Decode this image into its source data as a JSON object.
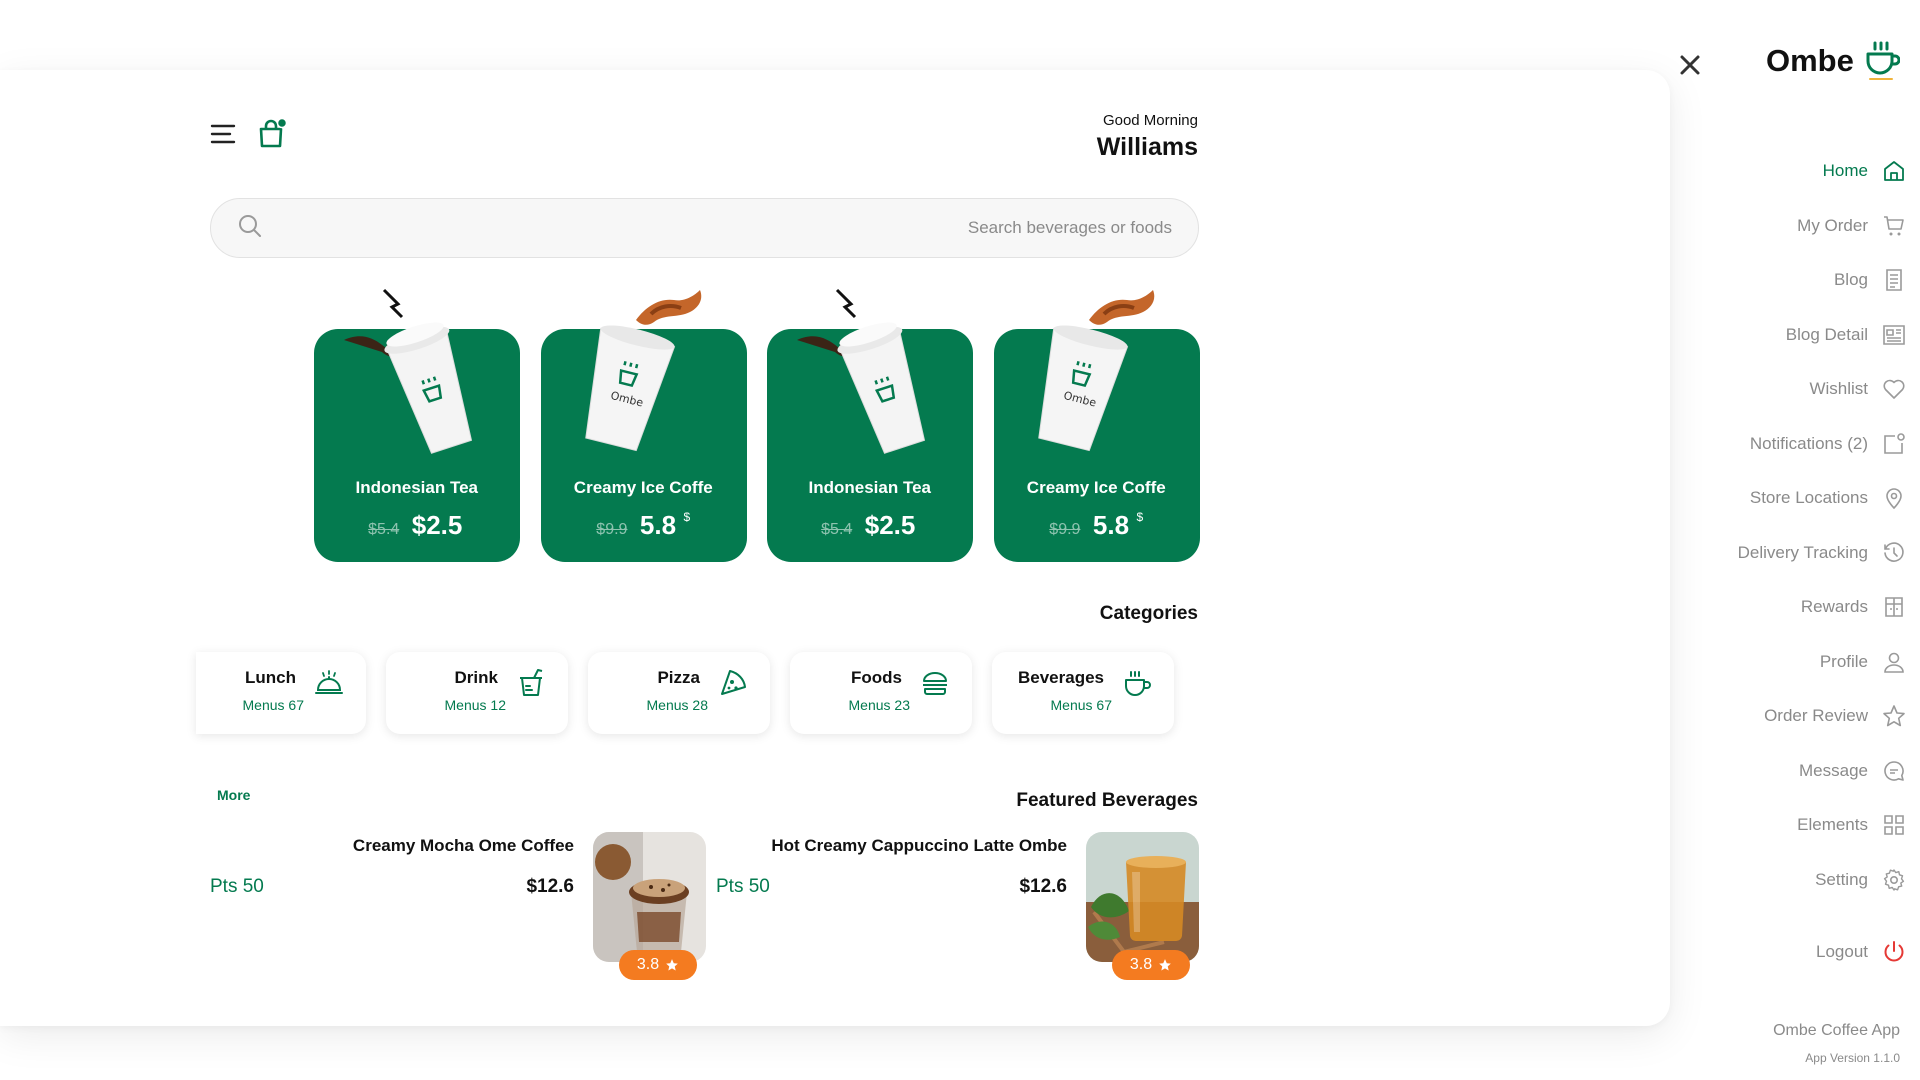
{
  "header": {
    "greeting": "Good Morning",
    "user_name": "Williams",
    "menu_icon": "menu-icon",
    "bag_icon": "shopping-bag-icon"
  },
  "search": {
    "placeholder": "Search beverages or foods"
  },
  "products": [
    {
      "name": "Indonesian Tea",
      "old_price": "$5.4",
      "price": "$2.5",
      "currency": ""
    },
    {
      "name": "Creamy Ice Coffe",
      "old_price": "$9.9",
      "price": "5.8",
      "currency": "$"
    },
    {
      "name": "Indonesian Tea",
      "old_price": "$5.4",
      "price": "$2.5",
      "currency": ""
    },
    {
      "name": "Creamy Ice Coffe",
      "old_price": "$9.9",
      "price": "5.8",
      "currency": "$"
    }
  ],
  "categories_title": "Categories",
  "categories": [
    {
      "label": "Lunch",
      "count": "Menus 67",
      "icon": "cloche-icon"
    },
    {
      "label": "Drink",
      "count": "Menus 12",
      "icon": "drink-icon"
    },
    {
      "label": "Pizza",
      "count": "Menus 28",
      "icon": "pizza-icon"
    },
    {
      "label": "Foods",
      "count": "Menus 23",
      "icon": "burger-icon"
    },
    {
      "label": "Beverages",
      "count": "Menus 67",
      "icon": "cup-icon"
    }
  ],
  "featured": {
    "title": "Featured Beverages",
    "more": "More",
    "items": [
      {
        "name": "Creamy Mocha Ome Coffee",
        "price": "$12.6",
        "points": "Pts 50",
        "rating": "3.8"
      },
      {
        "name": "Hot Creamy Cappuccino Latte Ombe",
        "price": "$12.6",
        "points": "Pts 50",
        "rating": "3.8"
      }
    ]
  },
  "sidebar": {
    "brand": "Ombe",
    "items": [
      {
        "label": "Home",
        "icon": "home-icon",
        "active": true
      },
      {
        "label": "My Order",
        "icon": "cart-icon"
      },
      {
        "label": "Blog",
        "icon": "document-icon"
      },
      {
        "label": "Blog Detail",
        "icon": "newspaper-icon"
      },
      {
        "label": "Wishlist",
        "icon": "heart-icon"
      },
      {
        "label": "Notifications (2)",
        "icon": "notification-icon"
      },
      {
        "label": "Store Locations",
        "icon": "location-pin-icon"
      },
      {
        "label": "Delivery Tracking",
        "icon": "clock-icon"
      },
      {
        "label": "Rewards",
        "icon": "gift-icon"
      },
      {
        "label": "Profile",
        "icon": "user-icon"
      },
      {
        "label": "Order Review",
        "icon": "star-icon"
      },
      {
        "label": "Message",
        "icon": "chat-icon"
      },
      {
        "label": "Elements",
        "icon": "grid-icon"
      },
      {
        "label": "Setting",
        "icon": "gear-icon"
      }
    ],
    "logout": "Logout",
    "app_name": "Ombe Coffee App",
    "app_version": "App Version 1.1.0"
  },
  "colors": {
    "brand_green": "#047a4f",
    "rating_orange": "#f47b20",
    "logout_red": "#e53935"
  }
}
